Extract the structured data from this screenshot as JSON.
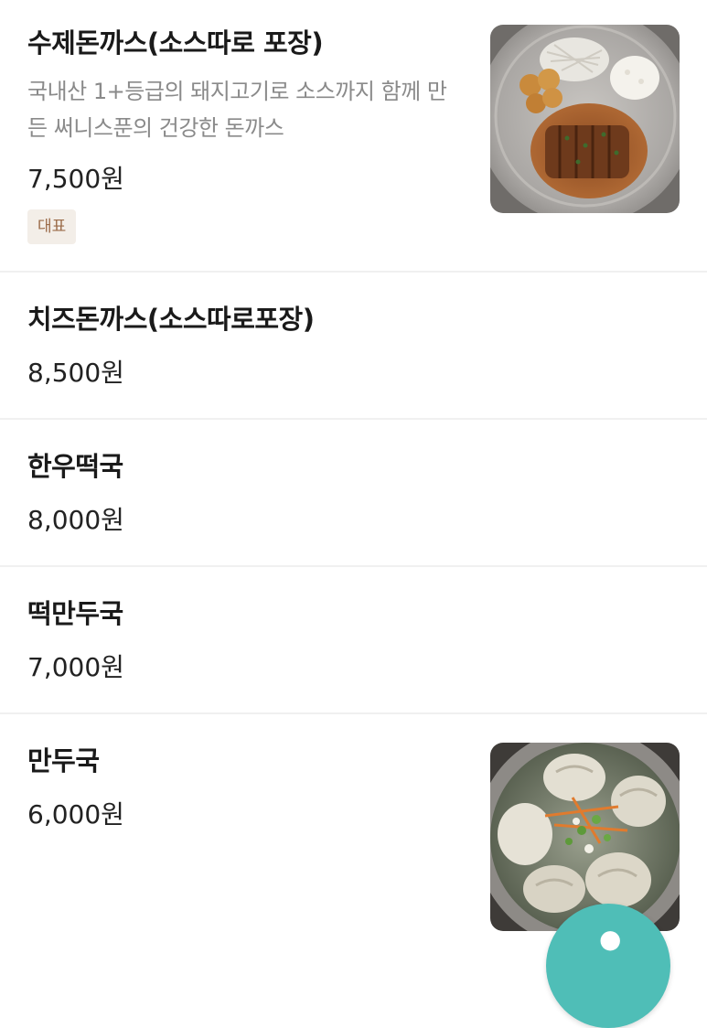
{
  "menu": {
    "items": [
      {
        "name": "수제돈까스(소스따로 포장)",
        "description": "국내산 1+등급의 돼지고기로 소스까지 함께 만든 써니스푼의 건강한 돈까스",
        "price": "7,500원",
        "badge": "대표",
        "image": "pork-cutlet-plate-photo"
      },
      {
        "name": "치즈돈까스(소스따로포장)",
        "price": "8,500원"
      },
      {
        "name": "한우떡국",
        "price": "8,000원"
      },
      {
        "name": "떡만두국",
        "price": "7,000원"
      },
      {
        "name": "만두국",
        "price": "6,000원",
        "image": "dumpling-soup-photo"
      }
    ]
  },
  "fab": {
    "color": "#4fbeb7",
    "icon": "cart-icon"
  }
}
